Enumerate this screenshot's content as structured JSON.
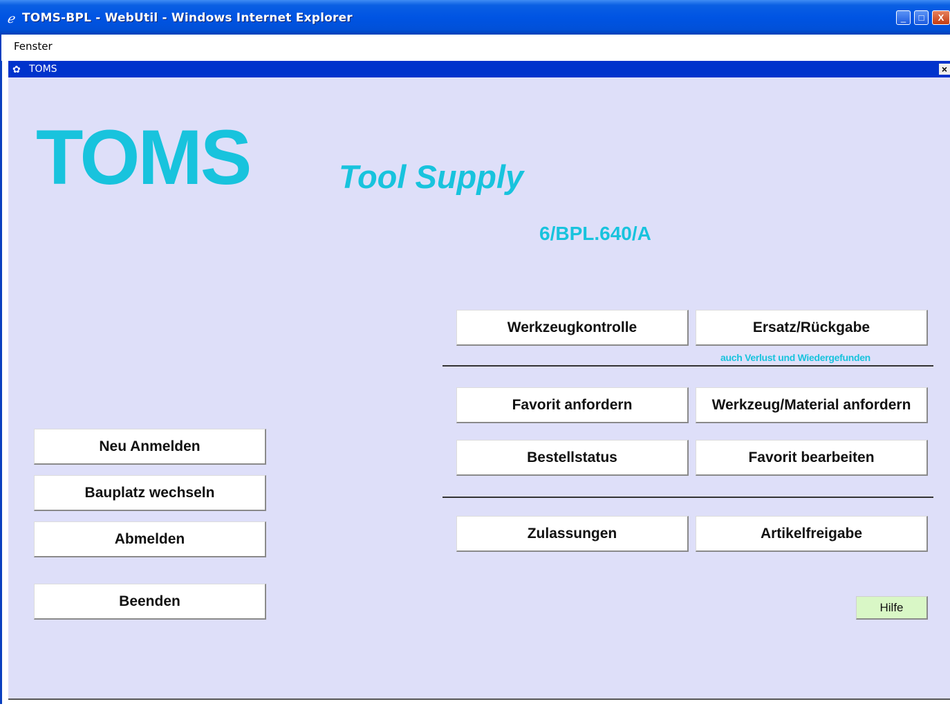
{
  "window": {
    "title": "TOMS-BPL - WebUtil - Windows Internet Explorer",
    "controls": {
      "minimize": "_",
      "maximize": "□",
      "close": "X"
    }
  },
  "menu": {
    "items": [
      "Fenster"
    ]
  },
  "inner_window": {
    "title": "TOMS",
    "close": "×"
  },
  "app": {
    "logo": "TOMS",
    "subtitle": "Tool Supply",
    "site_code": "6/BPL.640/A"
  },
  "left_buttons": {
    "new_login": "Neu Anmelden",
    "change_site": "Bauplatz wechseln",
    "logout": "Abmelden",
    "quit": "Beenden"
  },
  "right_buttons": {
    "tool_control": "Werkzeugkontrolle",
    "replace_return": "Ersatz/Rückgabe",
    "replace_return_note": "auch Verlust und Wiedergefunden",
    "request_favorite": "Favorit anfordern",
    "request_tool_material": "Werkzeug/Material anfordern",
    "order_status": "Bestellstatus",
    "edit_favorite": "Favorit bearbeiten",
    "approvals": "Zulassungen",
    "article_release": "Artikelfreigabe"
  },
  "help_button": "Hilfe",
  "colors": {
    "accent": "#18c3dd",
    "panel_bg": "#dedff9",
    "title_blue": "#0033cc",
    "help_bg": "#d9f7c6"
  }
}
